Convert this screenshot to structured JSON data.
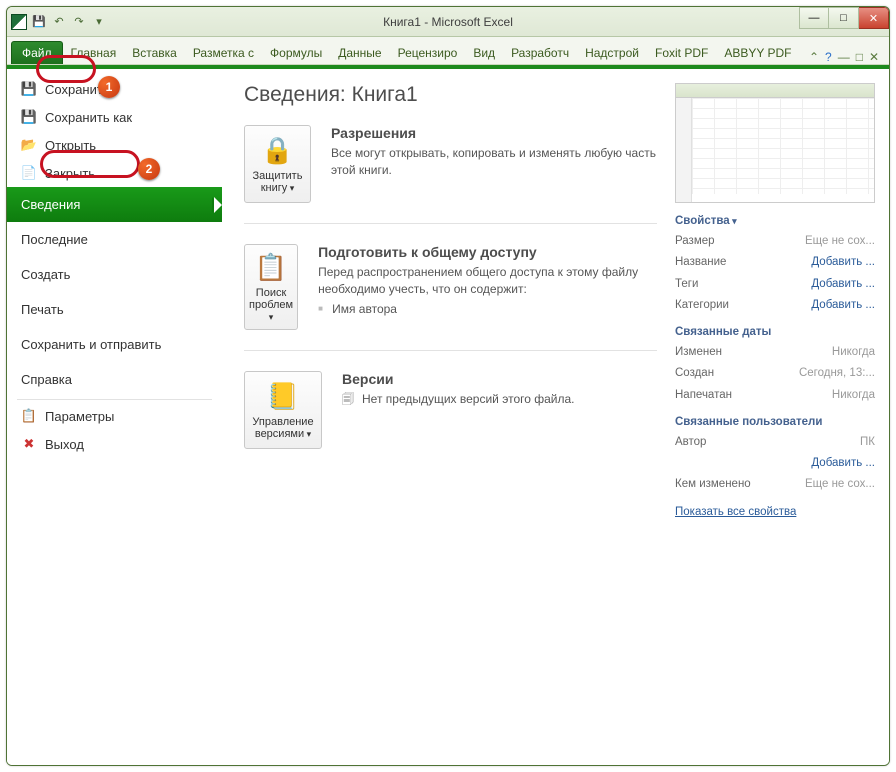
{
  "window": {
    "title": "Книга1 - Microsoft Excel"
  },
  "qat_icons": [
    "excel",
    "save",
    "undo",
    "redo",
    "print"
  ],
  "ribbon": {
    "file": "Файл",
    "tabs": [
      "Главная",
      "Вставка",
      "Разметка с",
      "Формулы",
      "Данные",
      "Рецензиро",
      "Вид",
      "Разработч",
      "Надстрой",
      "Foxit PDF",
      "ABBYY PDF"
    ]
  },
  "sidebar": {
    "top_items": [
      {
        "icon": "💾",
        "label": "Сохранить"
      },
      {
        "icon": "💾",
        "label": "Сохранить как"
      },
      {
        "icon": "📂",
        "label": "Открыть"
      },
      {
        "icon": "📄",
        "label": "Закрыть"
      }
    ],
    "active": "Сведения",
    "sections": [
      "Последние",
      "Создать",
      "Печать",
      "Сохранить и отправить",
      "Справка"
    ],
    "bottom_items": [
      {
        "icon": "📋",
        "label": "Параметры"
      },
      {
        "icon": "❌",
        "label": "Выход"
      }
    ]
  },
  "main": {
    "heading": "Сведения: Книга1",
    "blocks": [
      {
        "button": {
          "icon": "🔒",
          "label": "Защитить книгу"
        },
        "title": "Разрешения",
        "body": "Все могут открывать, копировать и изменять любую часть этой книги."
      },
      {
        "button": {
          "icon": "📋",
          "label": "Поиск проблем"
        },
        "title": "Подготовить к общему доступу",
        "body": "Перед распространением общего доступа к этому файлу необходимо учесть, что он содержит:",
        "bullet": "Имя автора"
      },
      {
        "button": {
          "icon": "📒",
          "label": "Управление версиями"
        },
        "title": "Версии",
        "body": "Нет предыдущих версий этого файла.",
        "body_icon": "🗐"
      }
    ]
  },
  "properties": {
    "heading": "Свойства",
    "rows": [
      {
        "k": "Размер",
        "v": "Еще не сох..."
      },
      {
        "k": "Название",
        "v": "Добавить ...",
        "blue": true
      },
      {
        "k": "Теги",
        "v": "Добавить ...",
        "blue": true
      },
      {
        "k": "Категории",
        "v": "Добавить ...",
        "blue": true
      }
    ],
    "dates_heading": "Связанные даты",
    "dates": [
      {
        "k": "Изменен",
        "v": "Никогда"
      },
      {
        "k": "Создан",
        "v": "Сегодня, 13:..."
      },
      {
        "k": "Напечатан",
        "v": "Никогда"
      }
    ],
    "people_heading": "Связанные пользователи",
    "people": [
      {
        "k": "Автор",
        "v": "ПК"
      },
      {
        "k": "",
        "v": "Добавить ...",
        "blue": true
      },
      {
        "k": "Кем изменено",
        "v": "Еще не сох..."
      }
    ],
    "show_all": "Показать все свойства"
  },
  "annotations": {
    "1": "1",
    "2": "2"
  }
}
